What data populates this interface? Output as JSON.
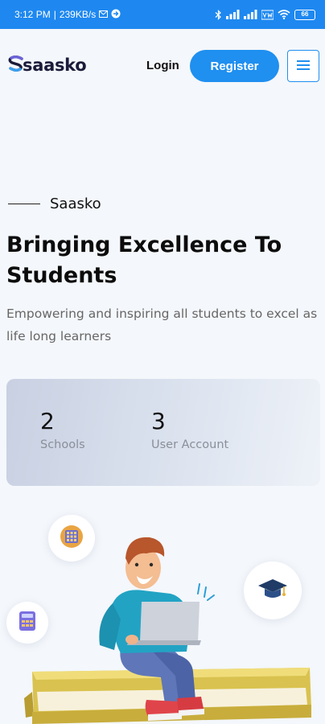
{
  "status_bar": {
    "time": "3:12 PM",
    "network_speed": "239KB/s",
    "battery": "66",
    "icons": [
      "mail-icon",
      "sync-icon",
      "bluetooth-icon",
      "signal-icon",
      "signal-icon",
      "vowifi-icon",
      "wifi-icon",
      "battery-icon"
    ]
  },
  "header": {
    "logo_text": "saasko",
    "login_label": "Login",
    "register_label": "Register"
  },
  "hero": {
    "eyebrow": "Saasko",
    "title": "Bringing Excellence To Students",
    "subtitle": "Empowering and inspiring all students to excel as life long learners"
  },
  "stats": [
    {
      "value": "2",
      "label": "Schools"
    },
    {
      "value": "3",
      "label": "User Account"
    }
  ],
  "colors": {
    "status_bar": "#1e88f0",
    "accent": "#1f8ff0",
    "background": "#f4f7fb"
  }
}
